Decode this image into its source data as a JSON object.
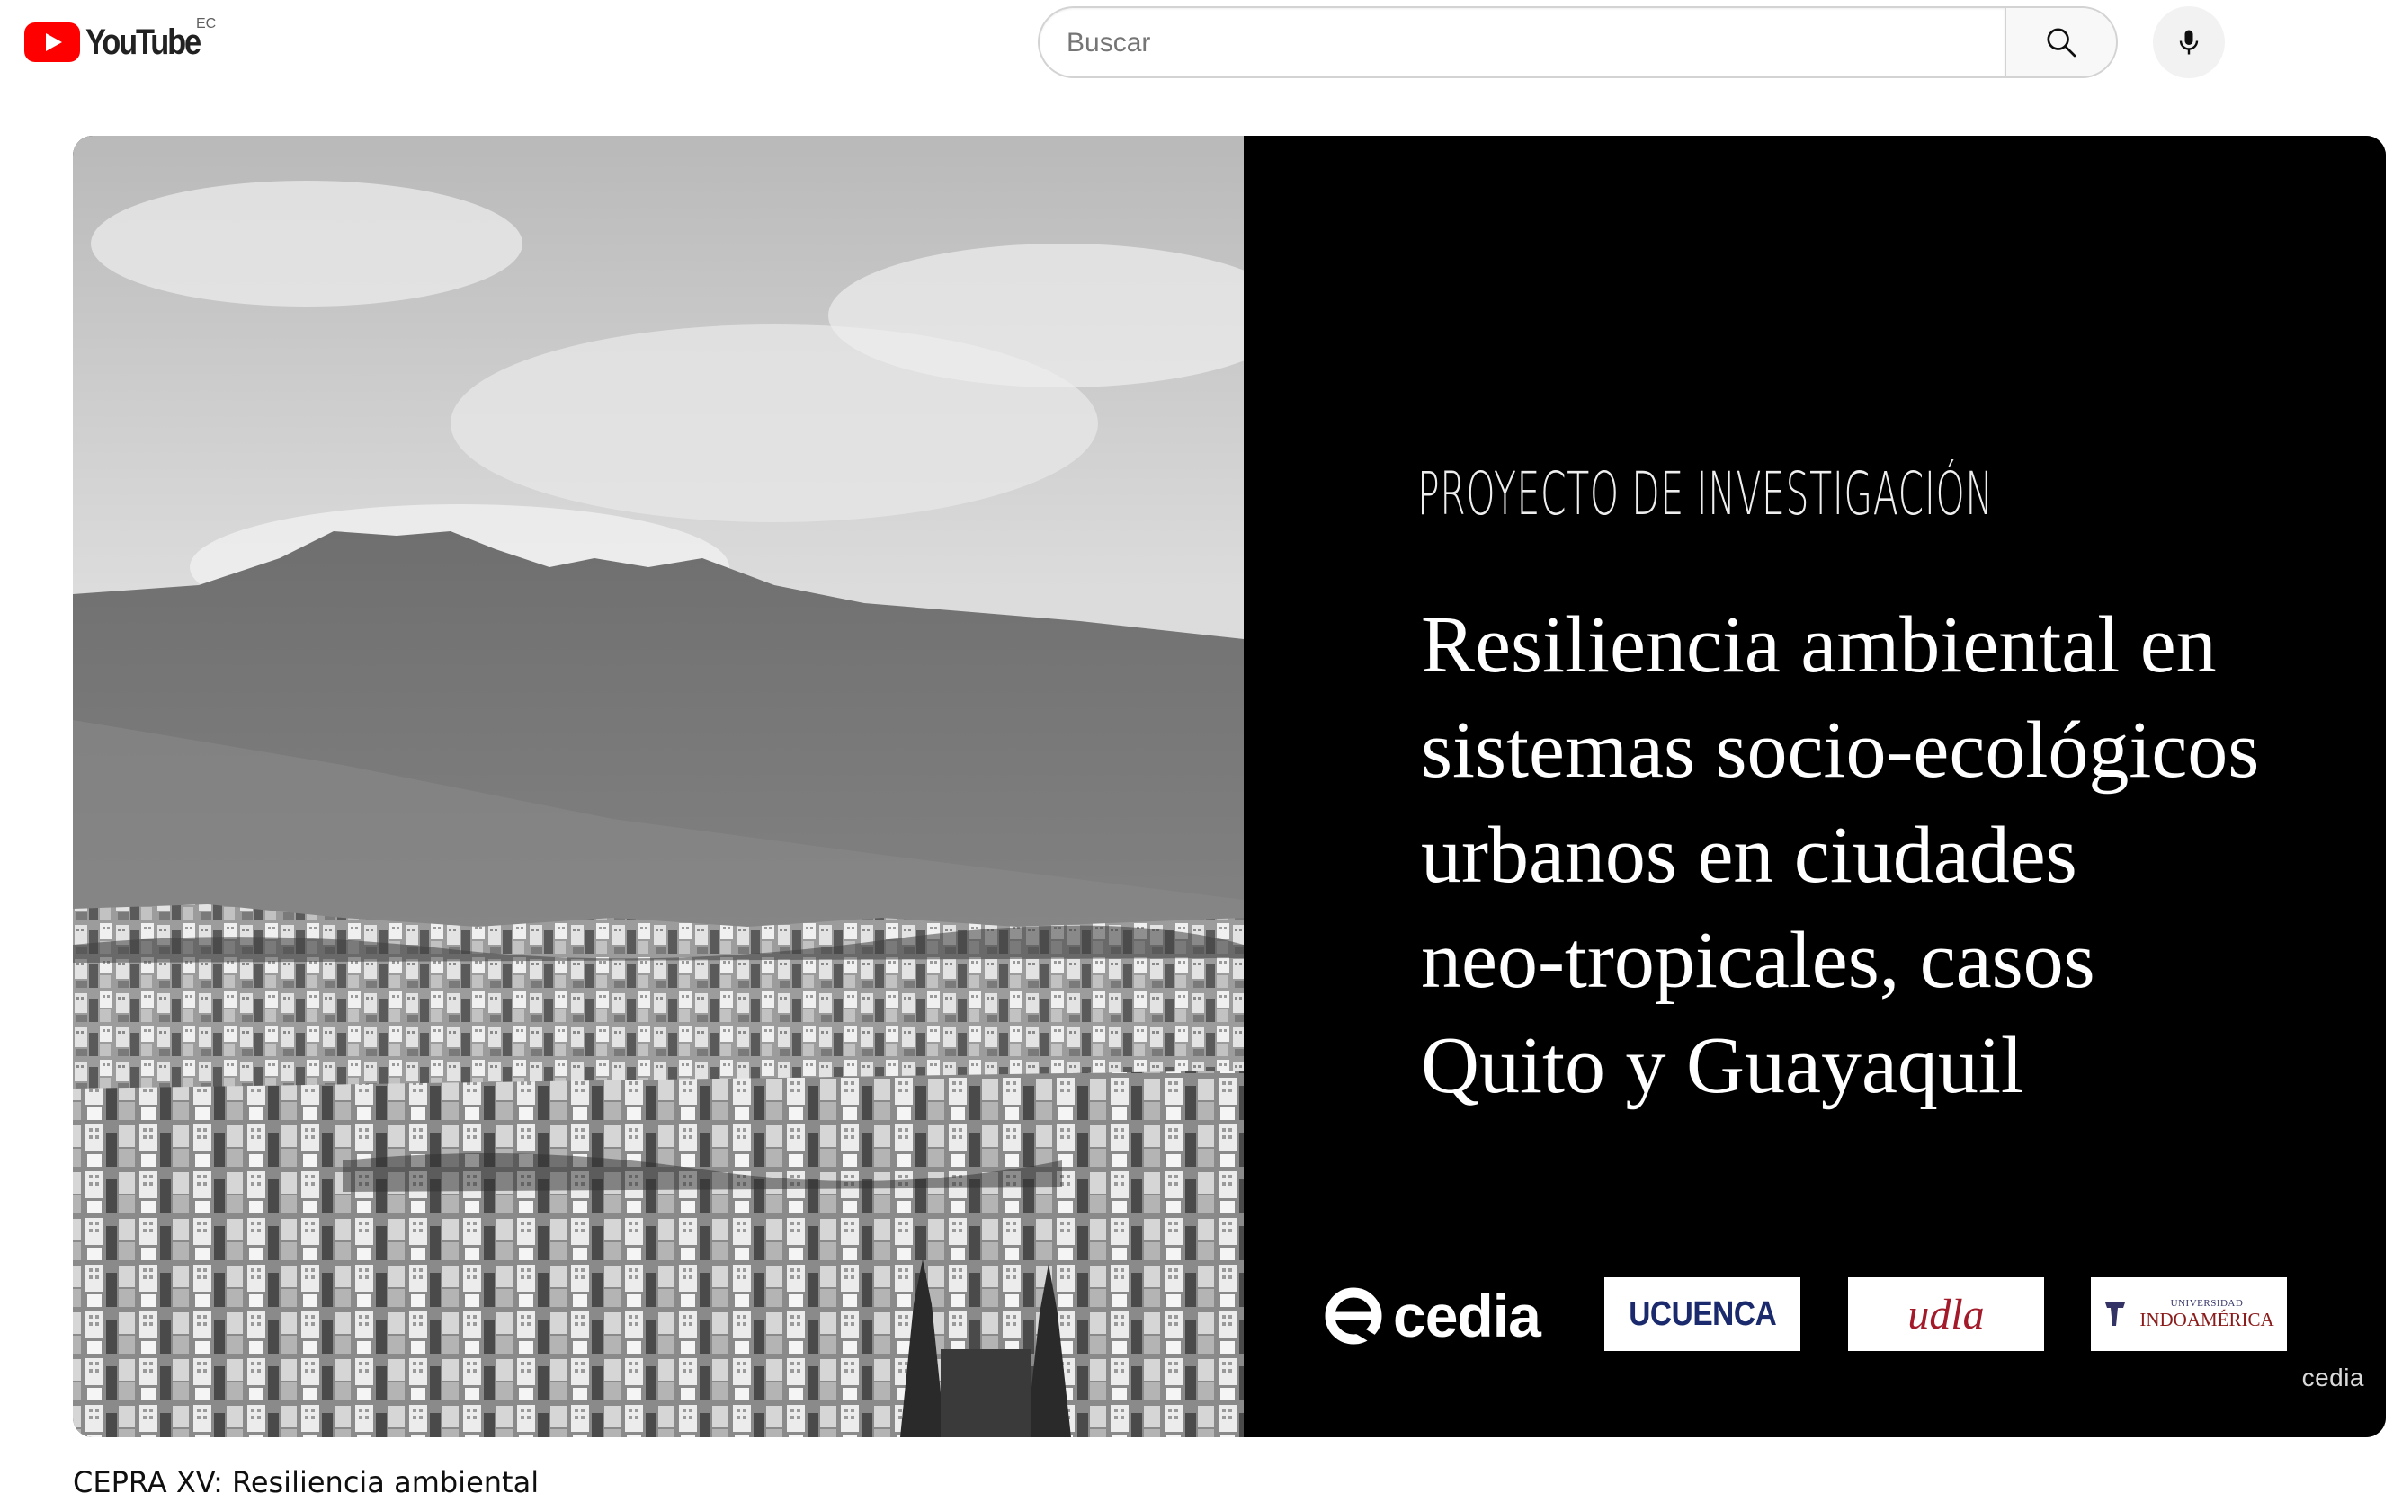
{
  "header": {
    "logo_text": "YouTube",
    "country_code": "EC",
    "search_placeholder": "Buscar",
    "search_value": ""
  },
  "icons": {
    "logo": "youtube-play-logo-icon",
    "search": "search-icon",
    "mic": "microphone-icon"
  },
  "slide": {
    "kicker": "PROYECTO DE INVESTIGACIÓN",
    "title_lines": [
      " Resiliencia ambiental en",
      "sistemas socio-ecológicos",
      "urbanos en ciudades",
      "neo-tropicales, casos",
      "Quito y Guayaquil"
    ],
    "partners": {
      "cedia": "cedia",
      "ucuenca": "UCUENCA",
      "udla": "udla",
      "indo_small": "UNIVERSIDAD",
      "indo_big": "INDOAMÉRICA"
    },
    "watermark": "cedia"
  },
  "video": {
    "title": "CEPRA XV: Resiliencia ambiental"
  },
  "colors": {
    "brand_red": "#ff0000",
    "slide_background": "#000000",
    "ucuenca_blue": "#1a2a6c",
    "udla_red": "#a31a2a"
  }
}
